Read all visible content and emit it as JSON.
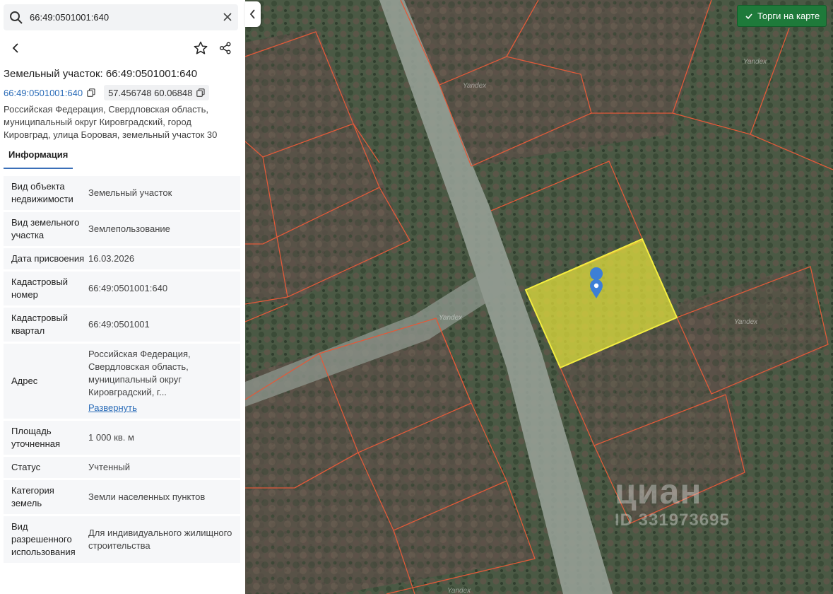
{
  "search": {
    "value": "66:49:0501001:640",
    "placeholder": ""
  },
  "title": "Земельный участок: 66:49:0501001:640",
  "cadastral_link": "66:49:0501001:640",
  "coordinates": "57.456748 60.06848",
  "address": "Российская Федерация, Свердловская область, муниципальный округ Кировградский, город Кировград, улица Боровая, земельный участок 30",
  "tabs": [
    {
      "label": "Информация",
      "active": true
    }
  ],
  "rows": [
    {
      "key": "Вид объекта недвижимости",
      "value": "Земельный участок"
    },
    {
      "key": "Вид земельного участка",
      "value": "Землепользование"
    },
    {
      "key": "Дата присвоения",
      "value": "16.03.2026"
    },
    {
      "key": "Кадастровый номер",
      "value": "66:49:0501001:640"
    },
    {
      "key": "Кадастровый квартал",
      "value": "66:49:0501001"
    },
    {
      "key": "Адрес",
      "value": "Российская Федерация, Свердловская область, муниципальный округ Кировградский, г...",
      "link": "Развернуть"
    },
    {
      "key": "Площадь уточненная",
      "value": "1 000 кв. м"
    },
    {
      "key": "Статус",
      "value": "Учтенный"
    },
    {
      "key": "Категория земель",
      "value": "Земли населенных пунктов"
    },
    {
      "key": "Вид разрешенного использования",
      "value": "Для индивидуального жилищного строительства"
    }
  ],
  "map": {
    "torgi_label": "Торги на карте",
    "watermark_brand": "циан",
    "watermark_id": "ID 331973695",
    "map_labels": [
      "Yandex",
      "Yandex",
      "Yandex",
      "Yandex",
      "Yandex"
    ],
    "colors": {
      "parcel_border": "#e05a3a",
      "selected_fill": "#e6e23c",
      "selected_border": "#f4ee40",
      "pin": "#3d7fd6",
      "torgi_bg": "#1e7a3a"
    }
  },
  "icons": [
    "search-icon",
    "close-icon",
    "back-arrow-icon",
    "star-icon",
    "share-icon",
    "copy-icon",
    "chevron-left-icon",
    "check-icon",
    "map-pin-icon"
  ]
}
